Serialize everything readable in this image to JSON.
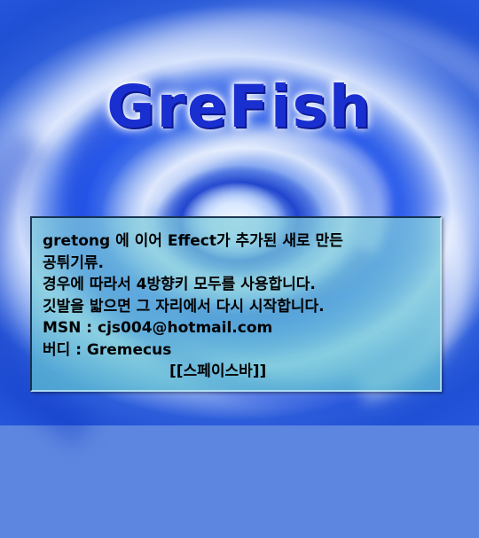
{
  "title": "GreFish",
  "info_lines": [
    "gretong 에 이어 Effect가 추가된 새로 만든",
    "공튀기류.",
    "경우에 따라서 4방향키 모두를 사용합니다.",
    "깃발을 밟으면 그 자리에서 다시 시작합니다.",
    "MSN : cjs004@hotmail.com",
    "버디 : Gremecus",
    "[[스페이스바]]"
  ],
  "colors": {
    "title": "#1a2fd0",
    "panel": "#7ccad8",
    "text": "#000000",
    "background": "#3f6fe2"
  }
}
